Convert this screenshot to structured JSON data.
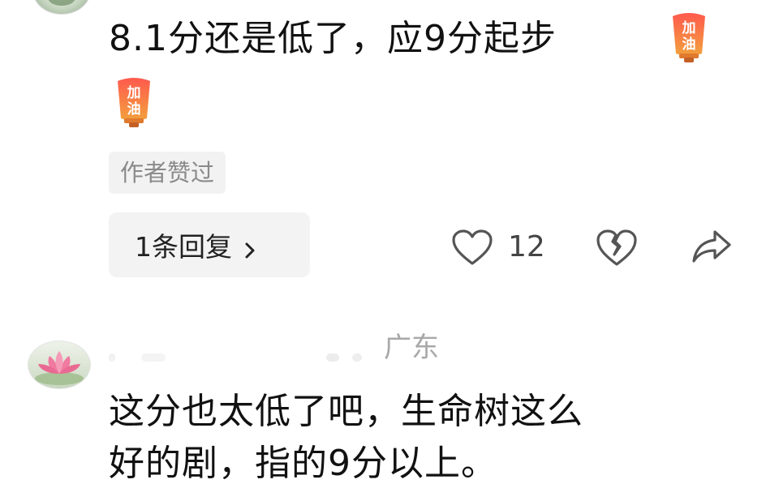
{
  "comment1": {
    "text_line1": "8.1分还是低了，应9分起步",
    "emoji_name": "加油",
    "emoji_chars": [
      "加",
      "油"
    ],
    "author_liked_tag": "作者赞过",
    "reply_button_label": "1条回复",
    "like_count": "12"
  },
  "comment2": {
    "location": "广东",
    "text_line1": "这分也太低了吧，生命树这么",
    "text_line2": "好的剧，指的9分以上。"
  },
  "colors": {
    "text": "#111111",
    "muted": "#8a8a8a",
    "icon_stroke": "#555555",
    "tag_bg": "#f2f2f2",
    "lantern_top": "#ff6a55",
    "lantern_bottom": "#f0a640"
  }
}
